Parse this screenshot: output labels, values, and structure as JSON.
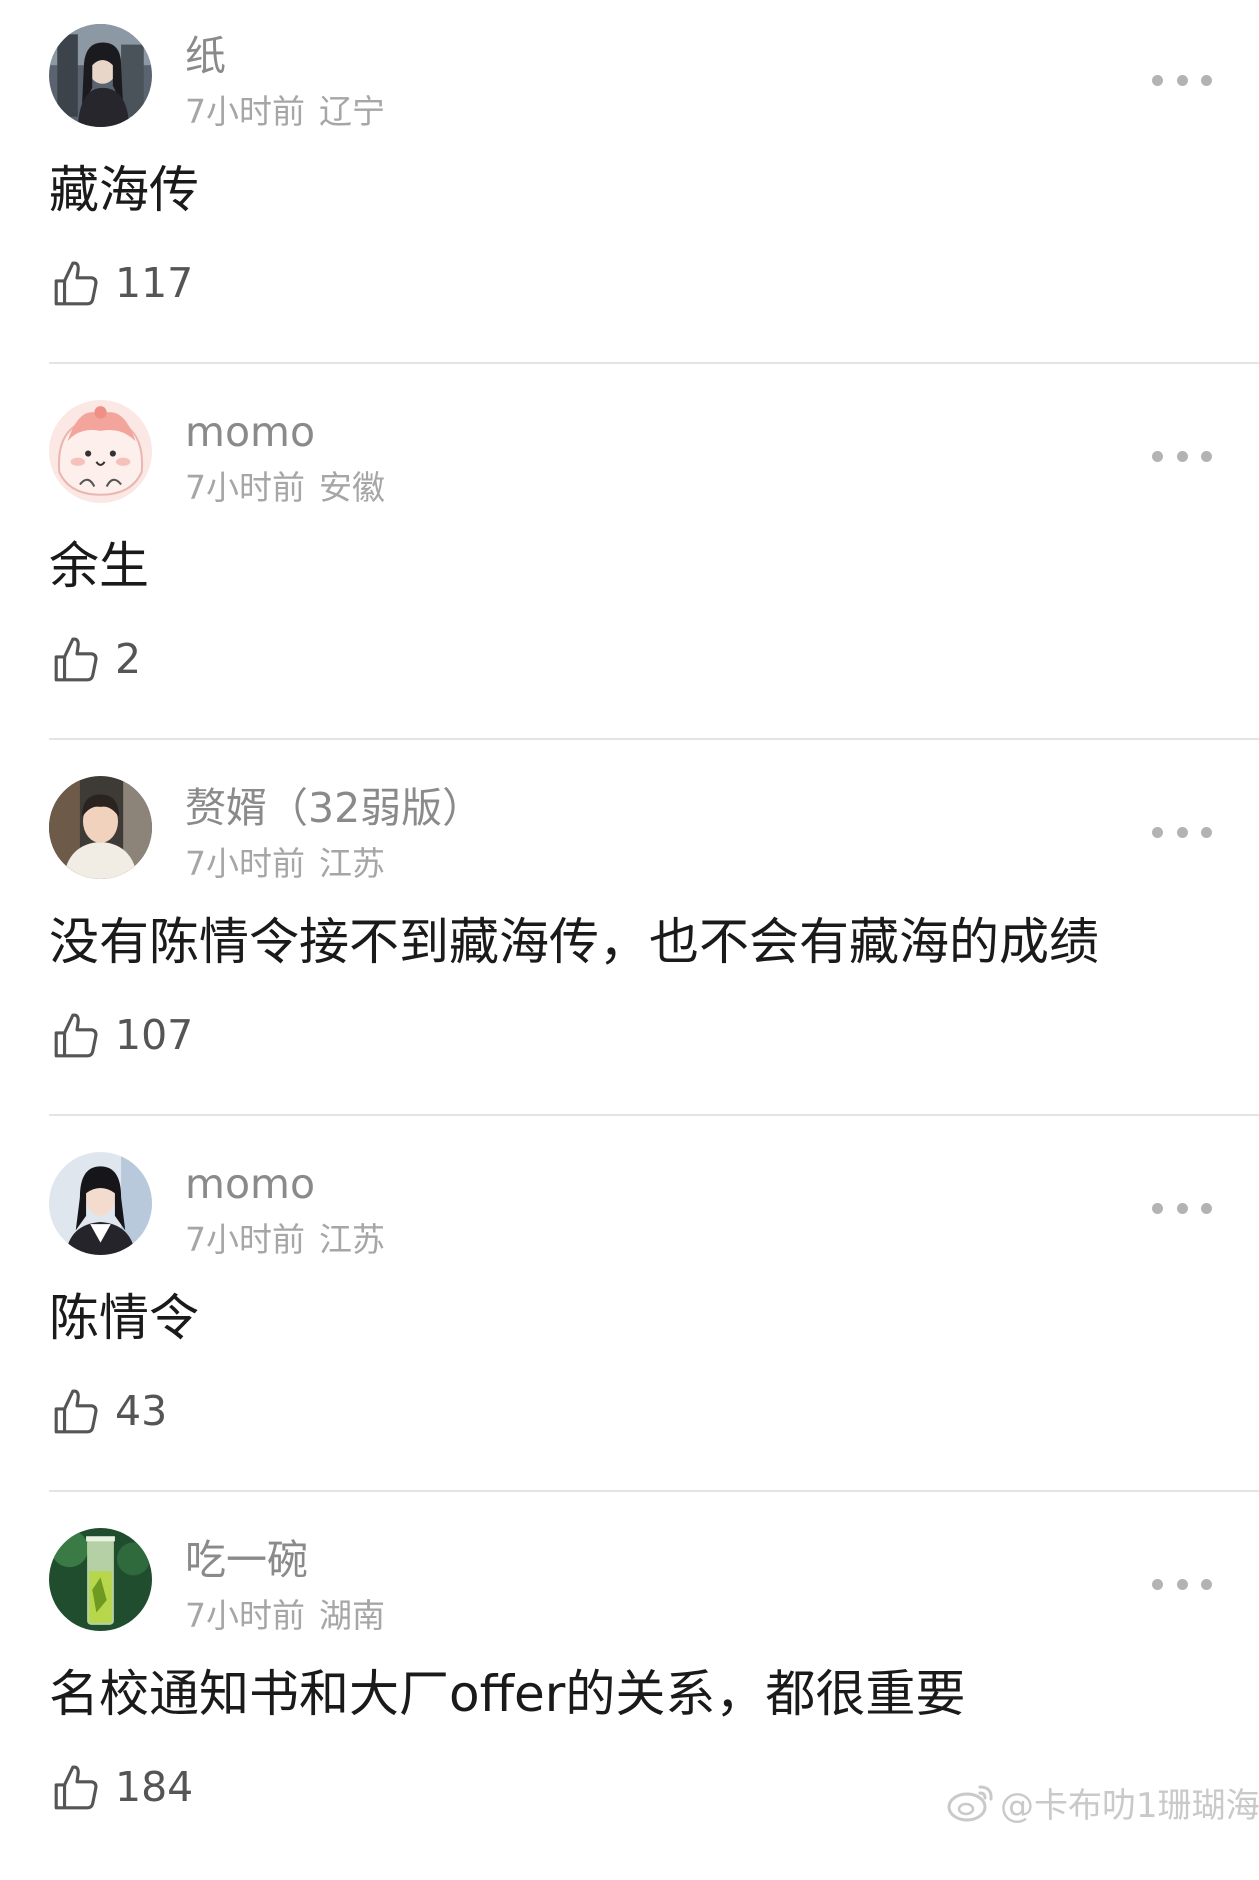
{
  "comments": [
    {
      "username": "纸",
      "time": "7小时前",
      "location": "辽宁",
      "text": "藏海传",
      "likes": "117"
    },
    {
      "username": "momo",
      "time": "7小时前",
      "location": "安徽",
      "text": "余生",
      "likes": "2"
    },
    {
      "username": "赘婿（32弱版）",
      "time": "7小时前",
      "location": "江苏",
      "text": "没有陈情令接不到藏海传，也不会有藏海的成绩",
      "likes": "107"
    },
    {
      "username": "momo",
      "time": "7小时前",
      "location": "江苏",
      "text": "陈情令",
      "likes": "43"
    },
    {
      "username": "吃一碗",
      "time": "7小时前",
      "location": "湖南",
      "text": "名校通知书和大厂offer的关系，都很重要",
      "likes": "184"
    }
  ],
  "watermark": "@卡布叻1珊瑚海",
  "icons": {
    "like": "thumbs-up-icon",
    "more": "more-options-icon",
    "watermark": "weibo-logo-icon"
  }
}
